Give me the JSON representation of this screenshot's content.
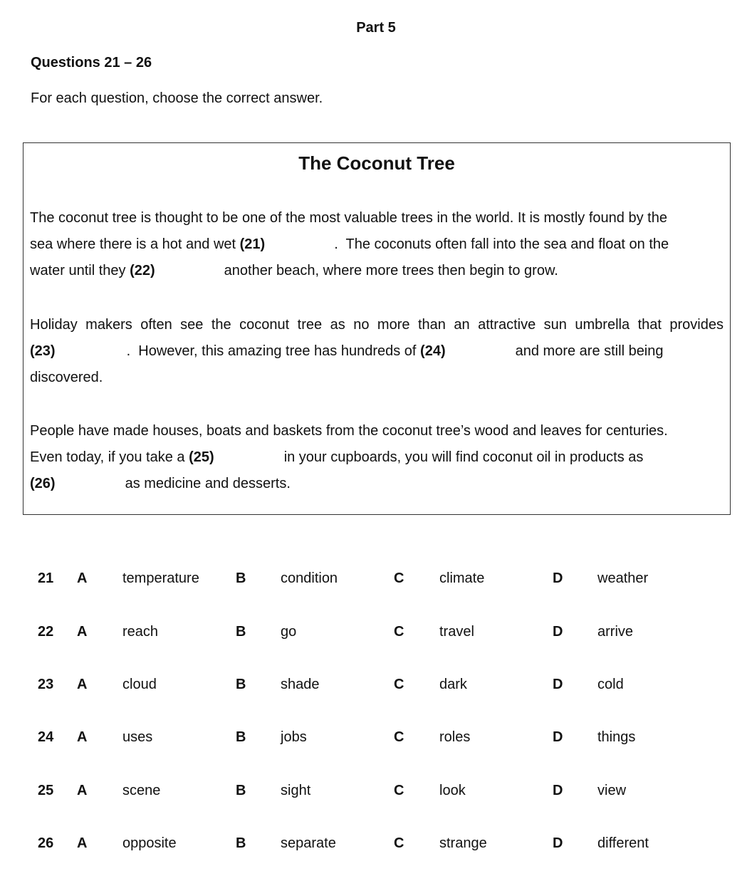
{
  "header": {
    "part_title": "Part 5",
    "questions_heading": "Questions 21 – 26",
    "instructions": "For each question, choose the correct answer."
  },
  "passage": {
    "title": "The Coconut Tree",
    "paragraphs": [
      {
        "lines": [
          {
            "text_before": "The coconut tree is thought to be one of the most valuable trees in the world. It is mostly found by the"
          },
          {
            "text_before": "sea where there is a hot and wet ",
            "gap": "(21)",
            "text_after": ".  The coconuts often fall into the sea and float on the"
          },
          {
            "text_before": "water until they ",
            "gap": "(22)",
            "text_after": "another beach, where more trees then begin to grow."
          }
        ]
      },
      {
        "lines": [
          {
            "text_before": "Holiday makers often see the coconut tree as no more than an attractive sun umbrella that provides"
          },
          {
            "text_before": "",
            "gap": "(23)",
            "text_after": ".  However, this amazing tree has hundreds of ",
            "gap2": "(24)",
            "text_after2": "and more are still being"
          },
          {
            "text_before": "discovered."
          }
        ]
      },
      {
        "lines": [
          {
            "text_before": "People have made houses, boats and baskets from the coconut tree’s wood and leaves for centuries."
          },
          {
            "text_before": "Even today, if you take a ",
            "gap": "(25)",
            "text_after": "in your cupboards, you will find coconut oil in products as"
          },
          {
            "text_before": "",
            "gap": "(26)",
            "text_after": "as medicine and desserts."
          }
        ]
      }
    ]
  },
  "questions": [
    {
      "number": "21",
      "options": [
        {
          "letter": "A",
          "text": "temperature"
        },
        {
          "letter": "B",
          "text": "condition"
        },
        {
          "letter": "C",
          "text": "climate"
        },
        {
          "letter": "D",
          "text": "weather"
        }
      ]
    },
    {
      "number": "22",
      "options": [
        {
          "letter": "A",
          "text": "reach"
        },
        {
          "letter": "B",
          "text": "go"
        },
        {
          "letter": "C",
          "text": "travel"
        },
        {
          "letter": "D",
          "text": "arrive"
        }
      ]
    },
    {
      "number": "23",
      "options": [
        {
          "letter": "A",
          "text": "cloud"
        },
        {
          "letter": "B",
          "text": "shade"
        },
        {
          "letter": "C",
          "text": "dark"
        },
        {
          "letter": "D",
          "text": "cold"
        }
      ]
    },
    {
      "number": "24",
      "options": [
        {
          "letter": "A",
          "text": "uses"
        },
        {
          "letter": "B",
          "text": "jobs"
        },
        {
          "letter": "C",
          "text": "roles"
        },
        {
          "letter": "D",
          "text": "things"
        }
      ]
    },
    {
      "number": "25",
      "options": [
        {
          "letter": "A",
          "text": "scene"
        },
        {
          "letter": "B",
          "text": "sight"
        },
        {
          "letter": "C",
          "text": "look"
        },
        {
          "letter": "D",
          "text": "view"
        }
      ]
    },
    {
      "number": "26",
      "options": [
        {
          "letter": "A",
          "text": "opposite"
        },
        {
          "letter": "B",
          "text": "separate"
        },
        {
          "letter": "C",
          "text": "strange"
        },
        {
          "letter": "D",
          "text": "different"
        }
      ]
    }
  ]
}
